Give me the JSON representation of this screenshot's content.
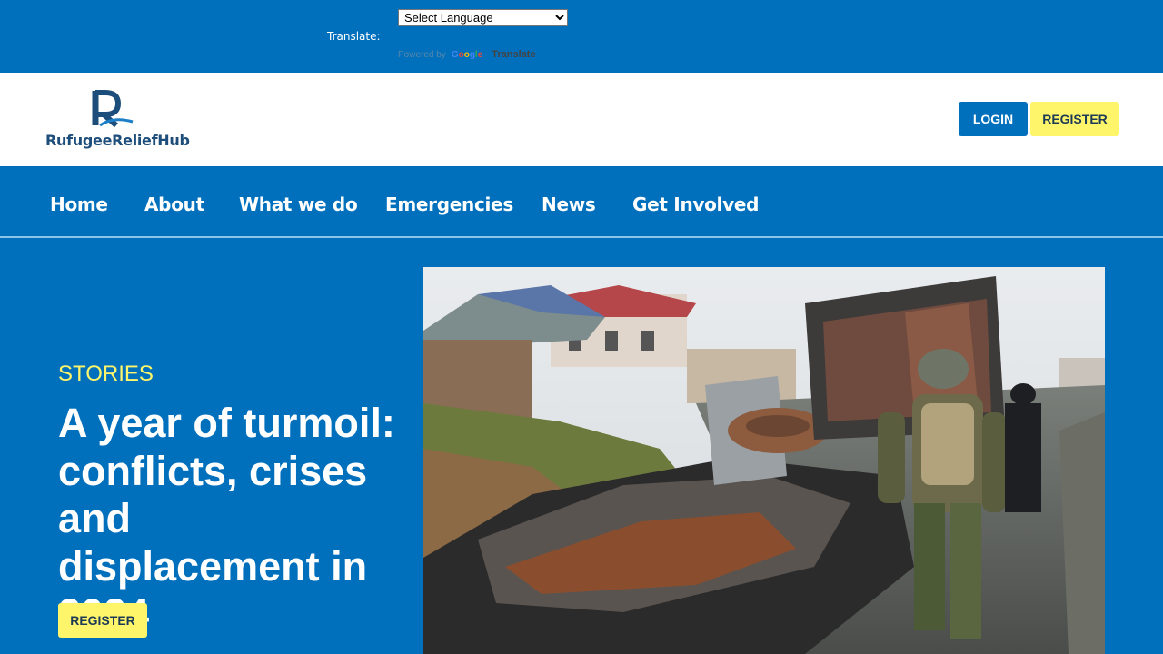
{
  "translate": {
    "label": "Translate:",
    "select_value": "Select Language",
    "powered_by": "Powered by",
    "google": "Google",
    "translate_word": "Translate"
  },
  "header": {
    "logo_text": "RufugeeReliefHub",
    "login_label": "LOGIN",
    "register_label": "REGISTER"
  },
  "nav": {
    "items": [
      {
        "label": "Home"
      },
      {
        "label": "About"
      },
      {
        "label": "What we do"
      },
      {
        "label": "Emergencies"
      },
      {
        "label": "News"
      },
      {
        "label": "Get Involved"
      }
    ]
  },
  "hero": {
    "tag": "STORIES",
    "title": "A year of turmoil: conflicts, crises and displacement in 2024",
    "button_label": "REGISTER"
  },
  "colors": {
    "brand_blue": "#0070bd",
    "accent_yellow": "#fff56b",
    "logo_navy": "#1d4d7a"
  }
}
